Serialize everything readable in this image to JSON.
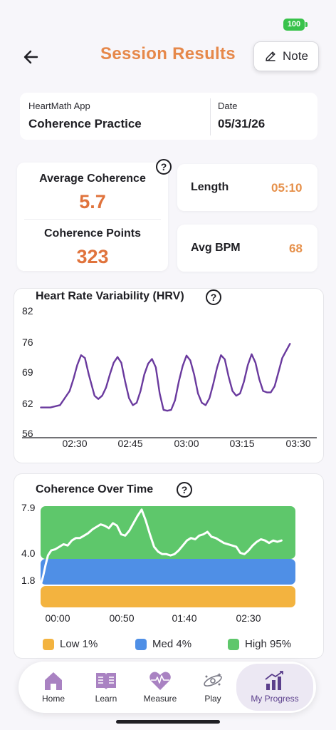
{
  "status": {
    "battery": "100"
  },
  "header": {
    "title": "Session Results",
    "note_label": "Note"
  },
  "info": {
    "app_label": "HeartMath App",
    "app_value": "Coherence Practice",
    "date_label": "Date",
    "date_value": "05/31/26"
  },
  "stats": {
    "avg_coherence_label": "Average Coherence",
    "avg_coherence_value": "5.7",
    "points_label": "Coherence Points",
    "points_value": "323",
    "length_label": "Length",
    "length_value": "05:10",
    "bpm_label": "Avg BPM",
    "bpm_value": "68",
    "help": "?"
  },
  "colors": {
    "accent_orange": "#e6884a",
    "hrv_line": "#6a3a9e",
    "low": "#f3b33f",
    "med": "#4f8fe6",
    "high": "#5ec76b",
    "active_tab": "#5b3f8c"
  },
  "chart_data": [
    {
      "type": "line",
      "title": "Heart Rate Variability (HRV)",
      "y_ticks": [
        "82",
        "76",
        "69",
        "62",
        "56"
      ],
      "x_ticks": [
        "02:30",
        "02:45",
        "03:00",
        "03:15",
        "03:30"
      ],
      "ylim": [
        56,
        82
      ],
      "x_seconds": [
        135,
        140,
        145,
        150,
        152,
        154,
        156,
        158,
        160,
        163,
        165,
        167,
        169,
        171,
        173,
        175,
        177,
        179,
        181,
        183,
        185,
        187,
        189,
        191,
        193,
        195,
        197,
        199,
        201,
        203,
        205,
        207,
        209,
        211,
        213,
        215,
        217,
        219,
        221,
        223,
        225,
        227,
        229,
        231,
        233,
        235,
        237,
        239,
        241,
        243,
        245,
        247,
        249,
        251,
        253,
        255,
        257,
        259,
        261,
        263,
        265,
        267,
        269,
        271,
        273,
        275
      ],
      "values": [
        61.5,
        61.5,
        62,
        65,
        67.5,
        70.5,
        72.6,
        72,
        68.5,
        64,
        63.3,
        64,
        65.7,
        68.5,
        71,
        72.2,
        71,
        67,
        63.5,
        62,
        62.5,
        65,
        68.5,
        70.8,
        71.8,
        70,
        64.5,
        61,
        60.8,
        61,
        63,
        67,
        70.3,
        72.5,
        71.5,
        68.5,
        64.5,
        62.5,
        62,
        63.5,
        66.5,
        70,
        72.6,
        71.7,
        68,
        65,
        64,
        64.5,
        67,
        70.5,
        72.8,
        71,
        67.5,
        65,
        64.7,
        64.7,
        66,
        69,
        72,
        73.5,
        75
      ],
      "xlim": [
        133,
        279
      ]
    },
    {
      "type": "area",
      "title": "Coherence Over Time",
      "y_ticks": [
        "7.9",
        "4.0",
        "1.8"
      ],
      "x_ticks": [
        "00:00",
        "00:50",
        "01:40",
        "02:30"
      ],
      "zones": [
        {
          "name": "Low",
          "from": 0,
          "to": 1.8
        },
        {
          "name": "Med",
          "from": 1.8,
          "to": 4.0
        },
        {
          "name": "High",
          "from": 4.0,
          "to": 7.9
        }
      ],
      "legend": [
        {
          "label": "Low 1%"
        },
        {
          "label": "Med 4%"
        },
        {
          "label": "High 95%"
        }
      ],
      "x_seconds": [
        0,
        3,
        6,
        9,
        13,
        18,
        23,
        28,
        33,
        38,
        43,
        48,
        53,
        58,
        63,
        68,
        73,
        78,
        83,
        88,
        93,
        98,
        103,
        108,
        113,
        118,
        123,
        128,
        133,
        138,
        143,
        148,
        153,
        158,
        163,
        168,
        173,
        178,
        183,
        188,
        193,
        198,
        203,
        208,
        213,
        218,
        223,
        228,
        233,
        238,
        243,
        248,
        253,
        258,
        263,
        268,
        273,
        278,
        283,
        288,
        293,
        298,
        303,
        308
      ],
      "values": [
        1.8,
        2.5,
        3.4,
        4.2,
        4.6,
        4.7,
        4.9,
        5.1,
        5.0,
        5.4,
        5.6,
        5.6,
        5.8,
        6.0,
        6.3,
        6.5,
        6.7,
        6.6,
        6.4,
        6.8,
        6.6,
        5.9,
        5.8,
        6.2,
        6.8,
        7.4,
        7.9,
        7.0,
        5.9,
        4.9,
        4.5,
        4.3,
        4.3,
        4.2,
        4.3,
        4.6,
        5.0,
        5.4,
        5.6,
        5.5,
        5.8,
        5.9,
        6.1,
        5.7,
        5.6,
        5.4,
        5.2,
        5.1,
        5.0,
        4.9,
        4.4,
        4.3,
        4.6,
        5.0,
        5.3,
        5.5,
        5.4,
        5.2,
        5.4,
        5.3,
        5.4
      ],
      "xlim": [
        0,
        310
      ],
      "ylim": [
        0,
        7.9
      ]
    }
  ],
  "nav": {
    "items": [
      {
        "label": "Home"
      },
      {
        "label": "Learn"
      },
      {
        "label": "Measure"
      },
      {
        "label": "Play"
      },
      {
        "label": "My Progress"
      }
    ]
  }
}
